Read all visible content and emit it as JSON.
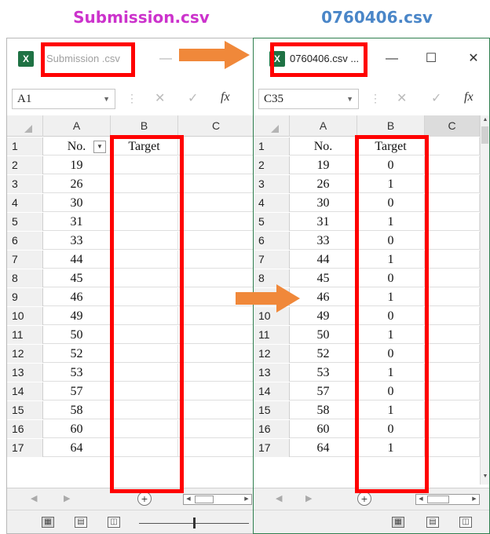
{
  "captions": {
    "left": "Submission.csv",
    "right": "0760406.csv"
  },
  "left_window": {
    "title": "Submission .csv",
    "name_box": "A1",
    "columns": [
      "A",
      "B",
      "C"
    ],
    "header_row": {
      "row": "1",
      "a": "No.",
      "b": "Target"
    },
    "rows": [
      {
        "n": "2",
        "a": "19",
        "b": ""
      },
      {
        "n": "3",
        "a": "26",
        "b": ""
      },
      {
        "n": "4",
        "a": "30",
        "b": ""
      },
      {
        "n": "5",
        "a": "31",
        "b": ""
      },
      {
        "n": "6",
        "a": "33",
        "b": ""
      },
      {
        "n": "7",
        "a": "44",
        "b": ""
      },
      {
        "n": "8",
        "a": "45",
        "b": ""
      },
      {
        "n": "9",
        "a": "46",
        "b": ""
      },
      {
        "n": "10",
        "a": "49",
        "b": ""
      },
      {
        "n": "11",
        "a": "50",
        "b": ""
      },
      {
        "n": "12",
        "a": "52",
        "b": ""
      },
      {
        "n": "13",
        "a": "53",
        "b": ""
      },
      {
        "n": "14",
        "a": "57",
        "b": ""
      },
      {
        "n": "15",
        "a": "58",
        "b": ""
      },
      {
        "n": "16",
        "a": "60",
        "b": ""
      },
      {
        "n": "17",
        "a": "64",
        "b": ""
      }
    ]
  },
  "right_window": {
    "title": "0760406.csv ...",
    "name_box": "C35",
    "columns": [
      "A",
      "B",
      "C"
    ],
    "header_row": {
      "row": "1",
      "a": "No.",
      "b": "Target"
    },
    "rows": [
      {
        "n": "2",
        "a": "19",
        "b": "0"
      },
      {
        "n": "3",
        "a": "26",
        "b": "1"
      },
      {
        "n": "4",
        "a": "30",
        "b": "0"
      },
      {
        "n": "5",
        "a": "31",
        "b": "1"
      },
      {
        "n": "6",
        "a": "33",
        "b": "0"
      },
      {
        "n": "7",
        "a": "44",
        "b": "1"
      },
      {
        "n": "8",
        "a": "45",
        "b": "0"
      },
      {
        "n": "9",
        "a": "46",
        "b": "1"
      },
      {
        "n": "10",
        "a": "49",
        "b": "0"
      },
      {
        "n": "11",
        "a": "50",
        "b": "1"
      },
      {
        "n": "12",
        "a": "52",
        "b": "0"
      },
      {
        "n": "13",
        "a": "53",
        "b": "1"
      },
      {
        "n": "14",
        "a": "57",
        "b": "0"
      },
      {
        "n": "15",
        "a": "58",
        "b": "1"
      },
      {
        "n": "16",
        "a": "60",
        "b": "0"
      },
      {
        "n": "17",
        "a": "64",
        "b": "1"
      }
    ]
  },
  "icons": {
    "app": "excel-icon",
    "minimize": "minimize-icon",
    "maximize": "maximize-icon",
    "close": "close-icon",
    "cancel": "cancel-icon",
    "enter": "check-icon",
    "function": "function-icon",
    "arrow": "arrow-right-icon"
  },
  "glyphs": {
    "excel": "X",
    "minimize": "—",
    "maximize": "☐",
    "close": "✕",
    "cancel": "✕",
    "enter": "✓",
    "fx": "fx",
    "dropdown": "▼",
    "nav_prev": "◀",
    "nav_next": "▶",
    "add_sheet": "+"
  },
  "colors": {
    "caption_left": "#cc33cc",
    "caption_right": "#4a86c8",
    "highlight": "#ff0000",
    "arrow": "#f0883a",
    "excel_green": "#1f7244"
  }
}
